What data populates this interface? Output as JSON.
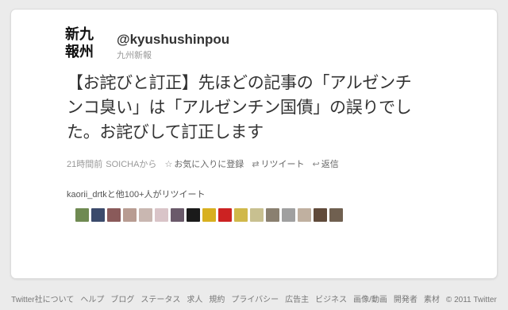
{
  "account": {
    "avatar_line1": "新九",
    "avatar_line2": "報州",
    "handle": "@kyushushinpou",
    "name": "九州新報"
  },
  "tweet": {
    "line1": "【お詫びと訂正】先ほどの記事の「アルゼンチ",
    "line2": "ンコ臭い」は「アルゼンチン国債」の誤りでし",
    "line3": "た。お詫びして訂正します",
    "time": "21時間前",
    "source": "SOICHAから",
    "favorite_label": "お気に入りに登録",
    "retweet_label": "リツイート",
    "reply_label": "返信"
  },
  "retweeters": {
    "text": "kaorii_drtkと他100+人がリツイート",
    "avatar_colors": [
      "#6f8a52",
      "#3b4a6b",
      "#8a5a5a",
      "#b89c92",
      "#c9b7b1",
      "#d9c4c8",
      "#6a5a6a",
      "#1a1a1a",
      "#d8b020",
      "#cc2222",
      "#d0b84a",
      "#c8c090",
      "#8a8070",
      "#a0a0a0",
      "#c0b0a0",
      "#604a3a",
      "#706050"
    ]
  },
  "footer": {
    "links": [
      "Twitter社について",
      "ヘルプ",
      "ブログ",
      "ステータス",
      "求人",
      "規約",
      "プライバシー",
      "広告主",
      "ビジネス",
      "画像/動画",
      "開発者",
      "素材"
    ],
    "copyright": "© 2011 Twitter"
  }
}
